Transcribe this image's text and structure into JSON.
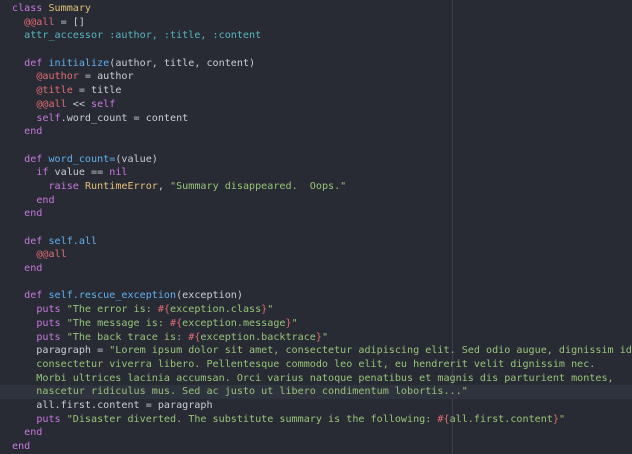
{
  "editor": {
    "language": "ruby",
    "colors": {
      "background": "#282b33",
      "keyword": "#c678dd",
      "class_name": "#e5c07b",
      "instance_var": "#e06c75",
      "symbol": "#56b6c2",
      "function": "#61afef",
      "string": "#98c379",
      "plain": "#c8ccd4"
    },
    "lines": [
      [
        [
          "kw",
          "class "
        ],
        [
          "cls",
          "Summary"
        ]
      ],
      [
        [
          "op",
          "  "
        ],
        [
          "ivar",
          "@@all"
        ],
        [
          "op",
          " = []"
        ]
      ],
      [
        [
          "op",
          "  "
        ],
        [
          "sym",
          "attr_accessor :author, :title, :content"
        ]
      ],
      [
        [
          "op",
          ""
        ]
      ],
      [
        [
          "op",
          "  "
        ],
        [
          "kw",
          "def "
        ],
        [
          "fn",
          "initialize"
        ],
        [
          "op",
          "(author, title, content)"
        ]
      ],
      [
        [
          "op",
          "    "
        ],
        [
          "ivar",
          "@author"
        ],
        [
          "op",
          " = author"
        ]
      ],
      [
        [
          "op",
          "    "
        ],
        [
          "ivar",
          "@title"
        ],
        [
          "op",
          " = title"
        ]
      ],
      [
        [
          "op",
          "    "
        ],
        [
          "ivar",
          "@@all"
        ],
        [
          "op",
          " << "
        ],
        [
          "kw",
          "self"
        ]
      ],
      [
        [
          "op",
          "    "
        ],
        [
          "kw",
          "self"
        ],
        [
          "op",
          ".word_count = content"
        ]
      ],
      [
        [
          "op",
          "  "
        ],
        [
          "kw",
          "end"
        ]
      ],
      [
        [
          "op",
          ""
        ]
      ],
      [
        [
          "op",
          "  "
        ],
        [
          "kw",
          "def "
        ],
        [
          "fn",
          "word_count="
        ],
        [
          "op",
          "(value)"
        ]
      ],
      [
        [
          "op",
          "    "
        ],
        [
          "kw",
          "if"
        ],
        [
          "op",
          " value == "
        ],
        [
          "kw",
          "nil"
        ]
      ],
      [
        [
          "op",
          "      "
        ],
        [
          "kw",
          "raise "
        ],
        [
          "cls",
          "RuntimeError"
        ],
        [
          "op",
          ", "
        ],
        [
          "str",
          "\"Summary disappeared.  Oops.\""
        ]
      ],
      [
        [
          "op",
          "    "
        ],
        [
          "kw",
          "end"
        ]
      ],
      [
        [
          "op",
          "  "
        ],
        [
          "kw",
          "end"
        ]
      ],
      [
        [
          "op",
          ""
        ]
      ],
      [
        [
          "op",
          "  "
        ],
        [
          "kw",
          "def "
        ],
        [
          "fn",
          "self.all"
        ]
      ],
      [
        [
          "op",
          "    "
        ],
        [
          "ivar",
          "@@all"
        ]
      ],
      [
        [
          "op",
          "  "
        ],
        [
          "kw",
          "end"
        ]
      ],
      [
        [
          "op",
          ""
        ]
      ],
      [
        [
          "op",
          "  "
        ],
        [
          "kw",
          "def "
        ],
        [
          "fn",
          "self.rescue_exception"
        ],
        [
          "op",
          "(exception)"
        ]
      ],
      [
        [
          "op",
          "    "
        ],
        [
          "kw",
          "puts "
        ],
        [
          "str",
          "\"The error is: "
        ],
        [
          "interp",
          "#{"
        ],
        [
          "str",
          "exception.class"
        ],
        [
          "interp",
          "}"
        ],
        [
          "str",
          "\""
        ]
      ],
      [
        [
          "op",
          "    "
        ],
        [
          "kw",
          "puts "
        ],
        [
          "str",
          "\"The message is: "
        ],
        [
          "interp",
          "#{"
        ],
        [
          "str",
          "exception.message"
        ],
        [
          "interp",
          "}"
        ],
        [
          "str",
          "\""
        ]
      ],
      [
        [
          "op",
          "    "
        ],
        [
          "kw",
          "puts "
        ],
        [
          "str",
          "\"The back trace is: "
        ],
        [
          "interp",
          "#{"
        ],
        [
          "str",
          "exception.backtrace"
        ],
        [
          "interp",
          "}"
        ],
        [
          "str",
          "\""
        ]
      ],
      [
        [
          "op",
          "    paragraph = "
        ],
        [
          "str",
          "\"Lorem ipsum dolor sit amet, consectetur adipiscing elit. Sed odio augue, dignissim id risus ac,"
        ]
      ],
      [
        [
          "str",
          "    consectetur viverra libero. Pellentesque commodo leo elit, eu hendrerit velit dignissim nec."
        ]
      ],
      [
        [
          "str",
          "    Morbi ultrices lacinia accumsan. Orci varius natoque penatibus et magnis dis parturient montes,"
        ]
      ],
      [
        [
          "str",
          "    nascetur ridiculus mus. Sed ac justo ut libero condimentum lobortis...\""
        ]
      ],
      [
        [
          "op",
          "    all.first.content = paragraph"
        ]
      ],
      [
        [
          "op",
          "    "
        ],
        [
          "kw",
          "puts "
        ],
        [
          "str",
          "\"Disaster diverted. The substitute summary is the following: "
        ],
        [
          "interp",
          "#{"
        ],
        [
          "str",
          "all.first.content"
        ],
        [
          "interp",
          "}"
        ],
        [
          "str",
          "\""
        ]
      ],
      [
        [
          "op",
          "  "
        ],
        [
          "kw",
          "end"
        ]
      ],
      [
        [
          "kw",
          "end"
        ]
      ]
    ],
    "current_line": 28
  }
}
